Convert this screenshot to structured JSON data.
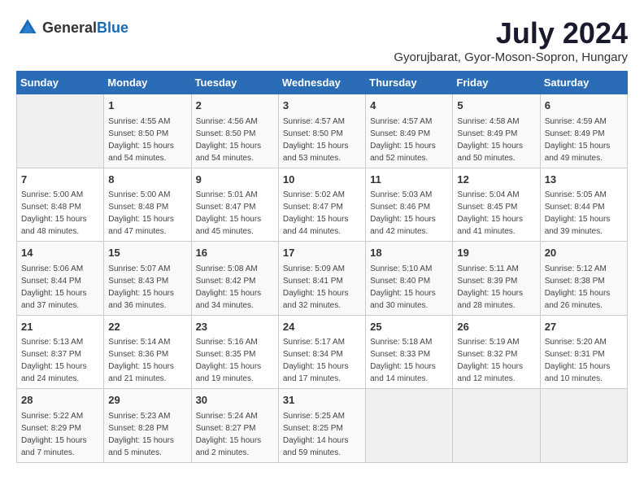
{
  "header": {
    "logo_general": "General",
    "logo_blue": "Blue",
    "month": "July 2024",
    "location": "Gyorujbarat, Gyor-Moson-Sopron, Hungary"
  },
  "days_of_week": [
    "Sunday",
    "Monday",
    "Tuesday",
    "Wednesday",
    "Thursday",
    "Friday",
    "Saturday"
  ],
  "weeks": [
    [
      {
        "day": "",
        "sunrise": "",
        "sunset": "",
        "daylight": ""
      },
      {
        "day": "1",
        "sunrise": "Sunrise: 4:55 AM",
        "sunset": "Sunset: 8:50 PM",
        "daylight": "Daylight: 15 hours and 54 minutes."
      },
      {
        "day": "2",
        "sunrise": "Sunrise: 4:56 AM",
        "sunset": "Sunset: 8:50 PM",
        "daylight": "Daylight: 15 hours and 54 minutes."
      },
      {
        "day": "3",
        "sunrise": "Sunrise: 4:57 AM",
        "sunset": "Sunset: 8:50 PM",
        "daylight": "Daylight: 15 hours and 53 minutes."
      },
      {
        "day": "4",
        "sunrise": "Sunrise: 4:57 AM",
        "sunset": "Sunset: 8:49 PM",
        "daylight": "Daylight: 15 hours and 52 minutes."
      },
      {
        "day": "5",
        "sunrise": "Sunrise: 4:58 AM",
        "sunset": "Sunset: 8:49 PM",
        "daylight": "Daylight: 15 hours and 50 minutes."
      },
      {
        "day": "6",
        "sunrise": "Sunrise: 4:59 AM",
        "sunset": "Sunset: 8:49 PM",
        "daylight": "Daylight: 15 hours and 49 minutes."
      }
    ],
    [
      {
        "day": "7",
        "sunrise": "Sunrise: 5:00 AM",
        "sunset": "Sunset: 8:48 PM",
        "daylight": "Daylight: 15 hours and 48 minutes."
      },
      {
        "day": "8",
        "sunrise": "Sunrise: 5:00 AM",
        "sunset": "Sunset: 8:48 PM",
        "daylight": "Daylight: 15 hours and 47 minutes."
      },
      {
        "day": "9",
        "sunrise": "Sunrise: 5:01 AM",
        "sunset": "Sunset: 8:47 PM",
        "daylight": "Daylight: 15 hours and 45 minutes."
      },
      {
        "day": "10",
        "sunrise": "Sunrise: 5:02 AM",
        "sunset": "Sunset: 8:47 PM",
        "daylight": "Daylight: 15 hours and 44 minutes."
      },
      {
        "day": "11",
        "sunrise": "Sunrise: 5:03 AM",
        "sunset": "Sunset: 8:46 PM",
        "daylight": "Daylight: 15 hours and 42 minutes."
      },
      {
        "day": "12",
        "sunrise": "Sunrise: 5:04 AM",
        "sunset": "Sunset: 8:45 PM",
        "daylight": "Daylight: 15 hours and 41 minutes."
      },
      {
        "day": "13",
        "sunrise": "Sunrise: 5:05 AM",
        "sunset": "Sunset: 8:44 PM",
        "daylight": "Daylight: 15 hours and 39 minutes."
      }
    ],
    [
      {
        "day": "14",
        "sunrise": "Sunrise: 5:06 AM",
        "sunset": "Sunset: 8:44 PM",
        "daylight": "Daylight: 15 hours and 37 minutes."
      },
      {
        "day": "15",
        "sunrise": "Sunrise: 5:07 AM",
        "sunset": "Sunset: 8:43 PM",
        "daylight": "Daylight: 15 hours and 36 minutes."
      },
      {
        "day": "16",
        "sunrise": "Sunrise: 5:08 AM",
        "sunset": "Sunset: 8:42 PM",
        "daylight": "Daylight: 15 hours and 34 minutes."
      },
      {
        "day": "17",
        "sunrise": "Sunrise: 5:09 AM",
        "sunset": "Sunset: 8:41 PM",
        "daylight": "Daylight: 15 hours and 32 minutes."
      },
      {
        "day": "18",
        "sunrise": "Sunrise: 5:10 AM",
        "sunset": "Sunset: 8:40 PM",
        "daylight": "Daylight: 15 hours and 30 minutes."
      },
      {
        "day": "19",
        "sunrise": "Sunrise: 5:11 AM",
        "sunset": "Sunset: 8:39 PM",
        "daylight": "Daylight: 15 hours and 28 minutes."
      },
      {
        "day": "20",
        "sunrise": "Sunrise: 5:12 AM",
        "sunset": "Sunset: 8:38 PM",
        "daylight": "Daylight: 15 hours and 26 minutes."
      }
    ],
    [
      {
        "day": "21",
        "sunrise": "Sunrise: 5:13 AM",
        "sunset": "Sunset: 8:37 PM",
        "daylight": "Daylight: 15 hours and 24 minutes."
      },
      {
        "day": "22",
        "sunrise": "Sunrise: 5:14 AM",
        "sunset": "Sunset: 8:36 PM",
        "daylight": "Daylight: 15 hours and 21 minutes."
      },
      {
        "day": "23",
        "sunrise": "Sunrise: 5:16 AM",
        "sunset": "Sunset: 8:35 PM",
        "daylight": "Daylight: 15 hours and 19 minutes."
      },
      {
        "day": "24",
        "sunrise": "Sunrise: 5:17 AM",
        "sunset": "Sunset: 8:34 PM",
        "daylight": "Daylight: 15 hours and 17 minutes."
      },
      {
        "day": "25",
        "sunrise": "Sunrise: 5:18 AM",
        "sunset": "Sunset: 8:33 PM",
        "daylight": "Daylight: 15 hours and 14 minutes."
      },
      {
        "day": "26",
        "sunrise": "Sunrise: 5:19 AM",
        "sunset": "Sunset: 8:32 PM",
        "daylight": "Daylight: 15 hours and 12 minutes."
      },
      {
        "day": "27",
        "sunrise": "Sunrise: 5:20 AM",
        "sunset": "Sunset: 8:31 PM",
        "daylight": "Daylight: 15 hours and 10 minutes."
      }
    ],
    [
      {
        "day": "28",
        "sunrise": "Sunrise: 5:22 AM",
        "sunset": "Sunset: 8:29 PM",
        "daylight": "Daylight: 15 hours and 7 minutes."
      },
      {
        "day": "29",
        "sunrise": "Sunrise: 5:23 AM",
        "sunset": "Sunset: 8:28 PM",
        "daylight": "Daylight: 15 hours and 5 minutes."
      },
      {
        "day": "30",
        "sunrise": "Sunrise: 5:24 AM",
        "sunset": "Sunset: 8:27 PM",
        "daylight": "Daylight: 15 hours and 2 minutes."
      },
      {
        "day": "31",
        "sunrise": "Sunrise: 5:25 AM",
        "sunset": "Sunset: 8:25 PM",
        "daylight": "Daylight: 14 hours and 59 minutes."
      },
      {
        "day": "",
        "sunrise": "",
        "sunset": "",
        "daylight": ""
      },
      {
        "day": "",
        "sunrise": "",
        "sunset": "",
        "daylight": ""
      },
      {
        "day": "",
        "sunrise": "",
        "sunset": "",
        "daylight": ""
      }
    ]
  ]
}
